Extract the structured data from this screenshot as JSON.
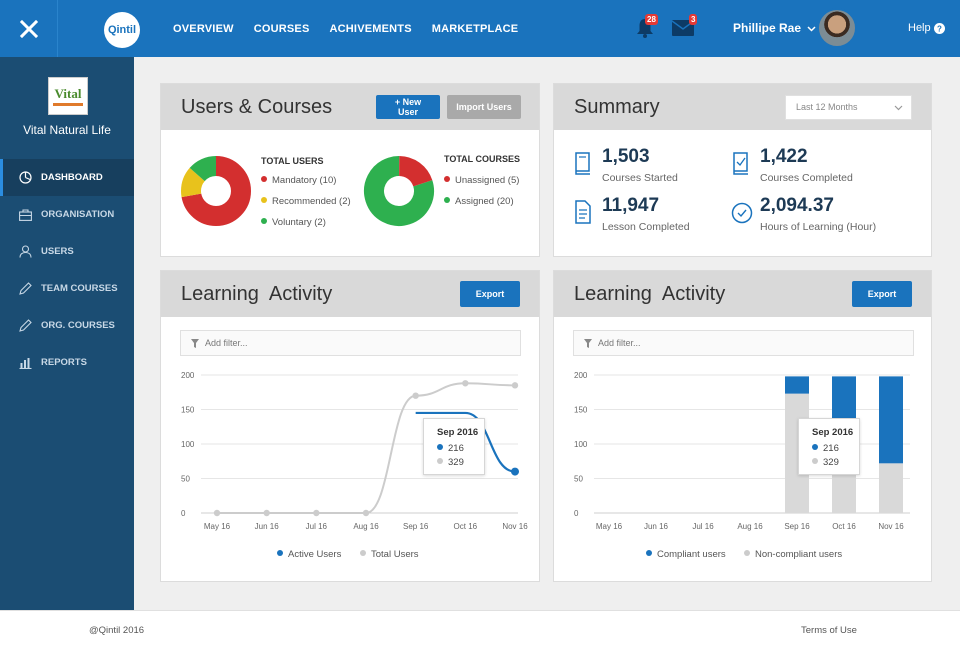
{
  "topbar": {
    "logo_text": "Qintil",
    "nav": [
      "OVERVIEW",
      "COURSES",
      "ACHIVEMENTS",
      "MARKETPLACE"
    ],
    "notifications_count": "28",
    "messages_count": "3",
    "user_name": "Phillipe Rae",
    "help_label": "Help",
    "brand_color": "#1a73bd"
  },
  "sidebar": {
    "org_logo_text": "Vital",
    "org_name": "Vital Natural Life",
    "items": [
      {
        "label": "DASHBOARD",
        "icon": "dashboard-icon",
        "active": true
      },
      {
        "label": "ORGANISATION",
        "icon": "briefcase-icon"
      },
      {
        "label": "USERS",
        "icon": "users-icon"
      },
      {
        "label": "TEAM COURSES",
        "icon": "pencil-icon"
      },
      {
        "label": "ORG. COURSES",
        "icon": "pencil-icon"
      },
      {
        "label": "REPORTS",
        "icon": "bar-chart-icon"
      }
    ]
  },
  "users_courses": {
    "title": "Users & Courses",
    "new_user_label": "+ New User",
    "import_users_label": "Import Users",
    "total_users_title": "TOTAL USERS",
    "total_users_legend": [
      "Mandatory (10)",
      "Recommended (2)",
      "Voluntary (2)"
    ],
    "total_courses_title": "TOTAL COURSES",
    "total_courses_legend": [
      "Unassigned (5)",
      "Assigned (20)"
    ],
    "colors": {
      "red": "#d32f2f",
      "yellow": "#e8c21c",
      "green": "#2eb04f"
    }
  },
  "summary": {
    "title": "Summary",
    "period": "Last 12 Months",
    "stats": [
      {
        "value": "1,503",
        "label": "Courses Started",
        "icon": "book-icon"
      },
      {
        "value": "1,422",
        "label": "Courses Completed",
        "icon": "checked-book-icon"
      },
      {
        "value": "11,947",
        "label": "Lesson Completed",
        "icon": "document-icon"
      },
      {
        "value": "2,094.37",
        "label": "Hours of Learning (Hour)",
        "icon": "clock-icon"
      }
    ]
  },
  "activity_left": {
    "title": "Learning  Activity",
    "export_label": "Export",
    "filter_placeholder": "Add filter...",
    "tooltip": {
      "title": "Sep 2016",
      "v1": "216",
      "v2": "329"
    },
    "legend": [
      "Active Users",
      "Total Users"
    ]
  },
  "activity_right": {
    "title": "Learning  Activity",
    "export_label": "Export",
    "filter_placeholder": "Add filter...",
    "tooltip": {
      "title": "Sep 2016",
      "v1": "216",
      "v2": "329"
    },
    "legend": [
      "Compliant users",
      "Non-compliant users"
    ]
  },
  "chart_data": [
    {
      "type": "line",
      "x": [
        "May 16",
        "Jun 16",
        "Jul 16",
        "Aug 16",
        "Sep 16",
        "Oct 16",
        "Nov 16"
      ],
      "yticks": [
        0,
        50,
        100,
        150,
        200
      ],
      "ylim": [
        0,
        200
      ],
      "series": [
        {
          "name": "Active Users",
          "color": "#1a73bd",
          "values": [
            0,
            0,
            0,
            0,
            145,
            145,
            60
          ]
        },
        {
          "name": "Total Users",
          "color": "#cccccc",
          "values": [
            0,
            0,
            0,
            0,
            170,
            188,
            185
          ]
        }
      ]
    },
    {
      "type": "bar",
      "categories": [
        "May 16",
        "Jun 16",
        "Jul 16",
        "Aug 16",
        "Sep 16",
        "Oct 16",
        "Nov 16"
      ],
      "yticks": [
        0,
        50,
        100,
        150,
        200
      ],
      "ylim": [
        0,
        200
      ],
      "stacked": true,
      "series": [
        {
          "name": "Non-compliant users",
          "color": "#d9d9d9",
          "values": [
            0,
            0,
            0,
            0,
            173,
            120,
            72
          ]
        },
        {
          "name": "Compliant users",
          "color": "#1a73bd",
          "values": [
            0,
            0,
            0,
            0,
            25,
            78,
            126
          ]
        }
      ]
    }
  ],
  "footer": {
    "copyright": "@Qintil 2016",
    "terms": "Terms of Use"
  }
}
